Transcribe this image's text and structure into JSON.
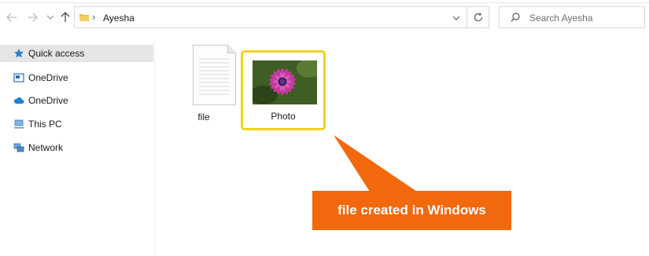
{
  "nav": {
    "back_icon": "arrow-left-icon",
    "forward_icon": "arrow-right-icon",
    "recent_icon": "chevron-down-icon",
    "up_icon": "arrow-up-icon"
  },
  "address": {
    "folder_icon": "folder-icon",
    "separator": "›",
    "path": "Ayesha",
    "dropdown_icon": "chevron-down-icon",
    "refresh_icon": "refresh-icon"
  },
  "search": {
    "placeholder": "Search Ayesha",
    "icon": "search-icon"
  },
  "sidebar": {
    "items": [
      {
        "label": "Quick access",
        "icon": "star-icon",
        "selected": true
      },
      {
        "label": "OneDrive",
        "icon": "onedrive-icon",
        "selected": false
      },
      {
        "label": "OneDrive",
        "icon": "cloud-icon",
        "selected": false
      },
      {
        "label": "This PC",
        "icon": "computer-icon",
        "selected": false
      },
      {
        "label": "Network",
        "icon": "network-icon",
        "selected": false
      }
    ]
  },
  "files": [
    {
      "name": "file",
      "icon": "text-document-icon",
      "highlighted": false
    },
    {
      "name": "Photo",
      "icon": "image-thumbnail-icon",
      "highlighted": true
    }
  ],
  "annotation": {
    "text": "file created in Windows",
    "color": "#f2680d",
    "highlight_color": "#f2d21c"
  }
}
